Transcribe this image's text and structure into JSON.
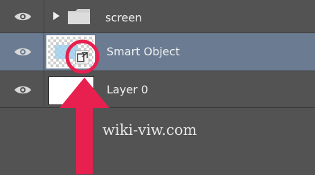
{
  "layers_panel": {
    "layers": [
      {
        "name": "screen",
        "type": "group",
        "visibility_icon": "eye-icon",
        "expand_icon": "caret-right-icon",
        "thumbnail_icon": "folder-icon"
      },
      {
        "name": "Smart Object",
        "type": "smart-object",
        "selected": true,
        "visibility_icon": "eye-icon",
        "badge_icon": "smart-object-badge-icon"
      },
      {
        "name": "Layer 0",
        "type": "pixel",
        "visibility_icon": "eye-icon"
      }
    ]
  },
  "annotation": {
    "highlight_color": "#e8204f",
    "arrow_icon": "up-arrow-icon",
    "circle_icon": "highlight-circle-icon"
  },
  "watermark": {
    "text": "wiki-viw.com"
  },
  "colors": {
    "panel_bg": "#535353",
    "selected_row_bg": "#6b7c92",
    "text": "#f0f0f0"
  }
}
